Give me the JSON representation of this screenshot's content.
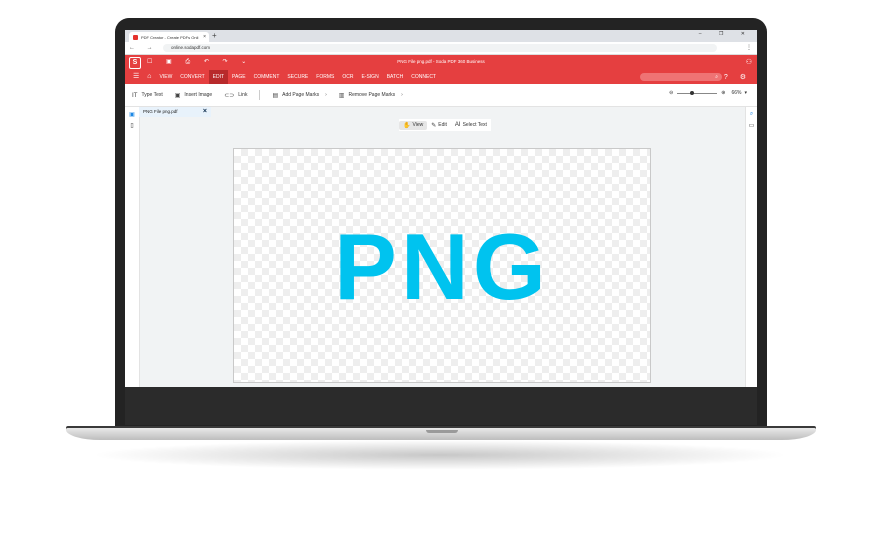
{
  "browser": {
    "tab_title": "PDF Creator - Create PDFs Onli",
    "tab_close": "×",
    "new_tab": "+",
    "window_controls": "– ❐ ✕",
    "nav_icons": "← → ⟳",
    "url": "online.sodapdf.com",
    "menu": "⋮"
  },
  "app": {
    "logo": "S",
    "quick_icons": "☐ ▣ ⎙ ↶ ↷ ⌄",
    "title": "PNG File png.pdf - Soda PDF 360 Business",
    "account_icon": "⚇",
    "menu_icon": "☰",
    "home_icon": "⌂",
    "menu": [
      "VIEW",
      "CONVERT",
      "EDIT",
      "PAGE",
      "COMMENT",
      "SECURE",
      "FORMS",
      "OCR",
      "E-SIGN",
      "BATCH",
      "CONNECT"
    ],
    "active_menu": "EDIT",
    "search_icon": "⌕",
    "help_icons": "? ⚙"
  },
  "ribbon": {
    "type_text": "Type Text",
    "insert_image": "Insert Image",
    "link": "Link",
    "add_page_marks": "Add Page Marks",
    "remove_page_marks": "Remove Page Marks",
    "zoom": "66%",
    "zoom_minus": "⊖",
    "zoom_plus": "⊕"
  },
  "document": {
    "tab_label": "PNG File png.pdf",
    "tab_close": "×",
    "modes": [
      "View",
      "Edit",
      "Select Text"
    ],
    "active_mode": "View",
    "content_text": "PNG",
    "content_color": "#00c3ef"
  },
  "colors": {
    "brand_red": "#e53f40",
    "active_menu_bg": "#b82a2b"
  }
}
